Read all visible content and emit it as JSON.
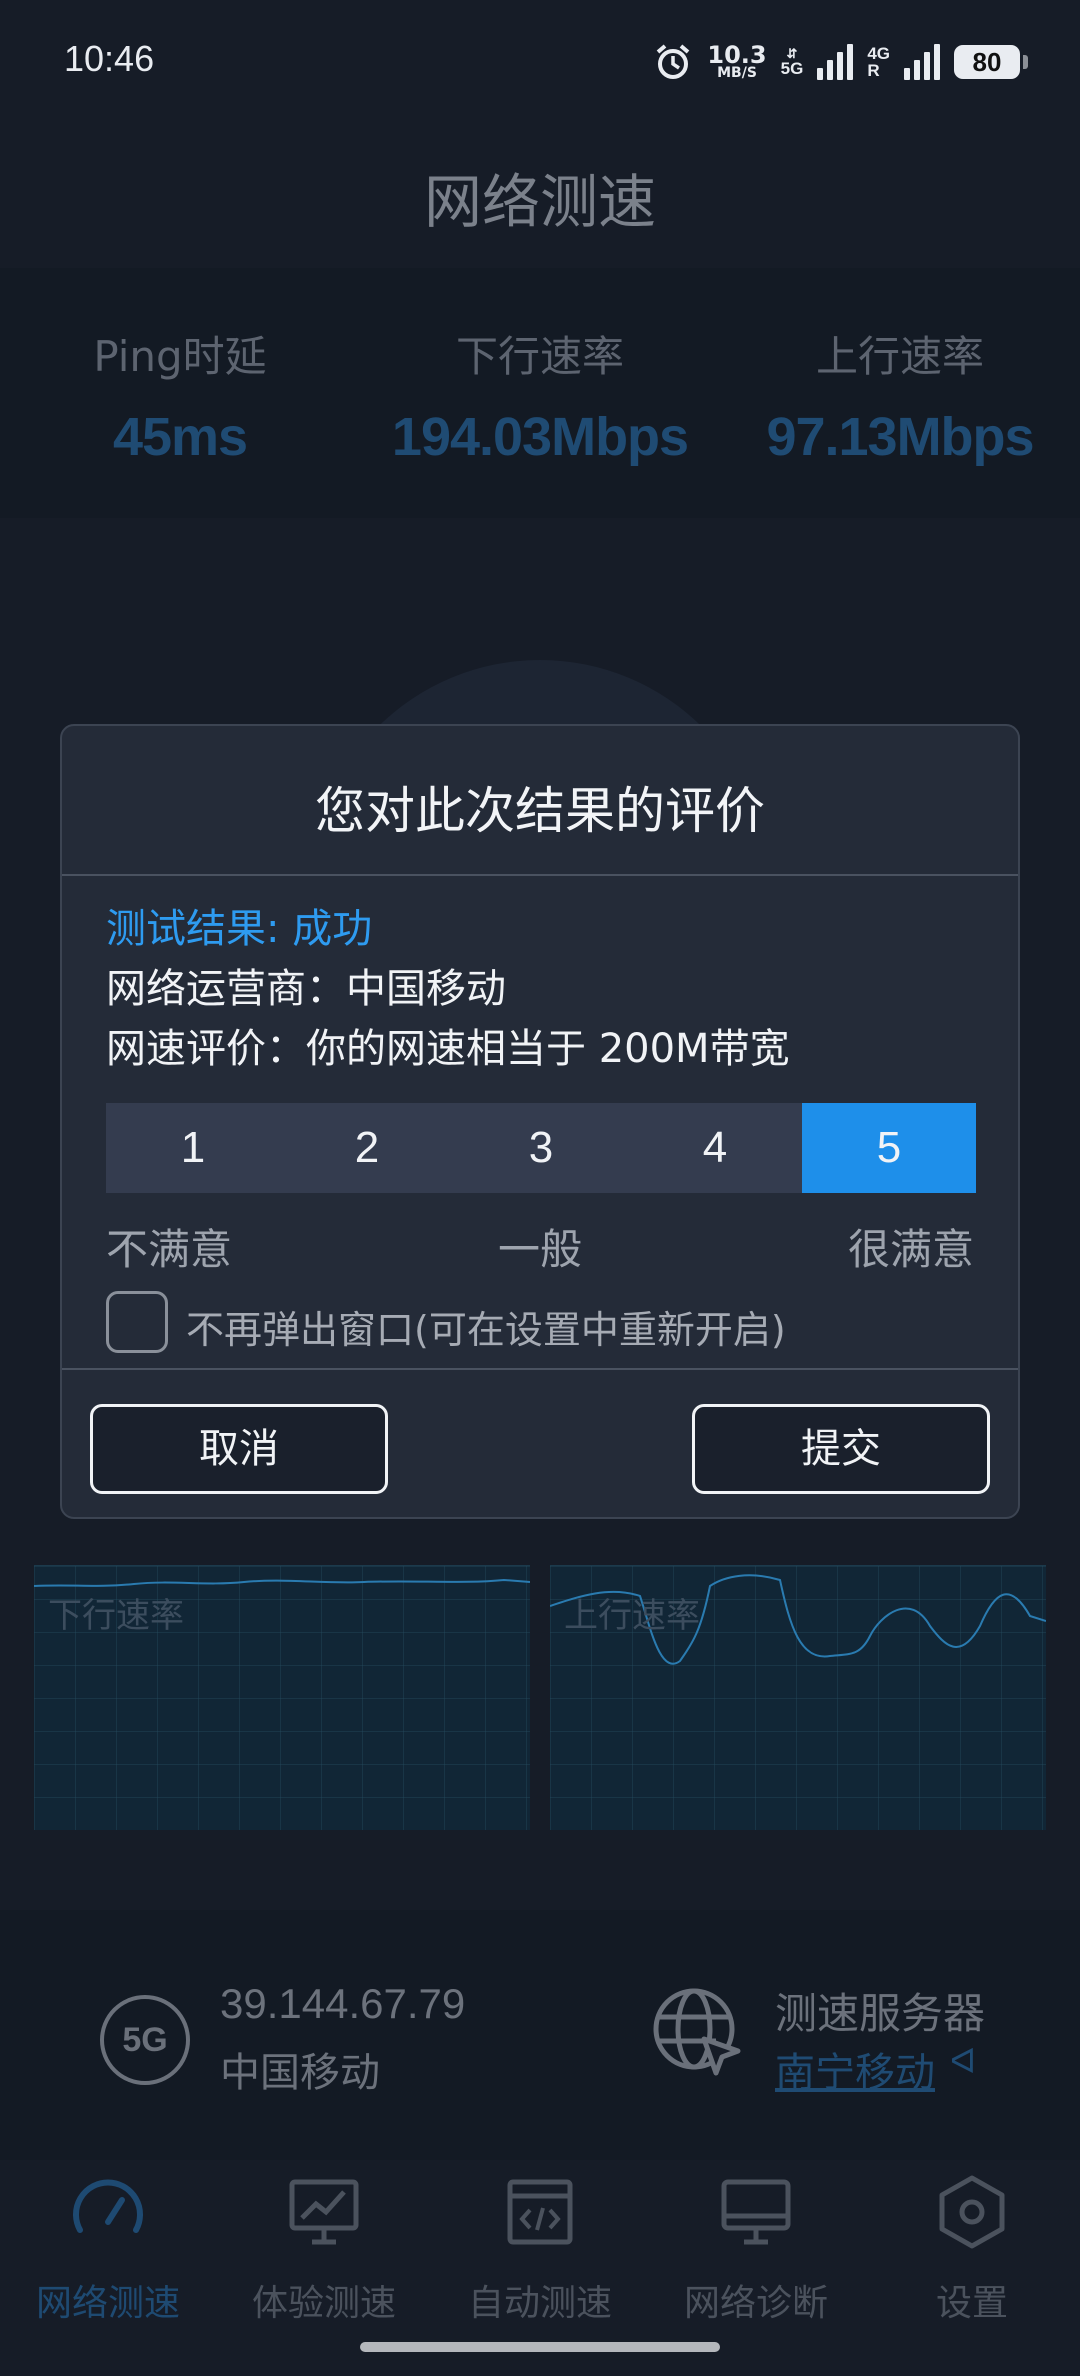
{
  "status_bar": {
    "time": "10:46",
    "net_speed_value": "10.3",
    "net_speed_unit": "MB/S",
    "sim1_type": "5G",
    "sim2_type": "4G",
    "sim2_roaming": "R",
    "battery": "80"
  },
  "page": {
    "title": "网络测速"
  },
  "metrics": {
    "ping_label": "Ping时延",
    "ping_value": "45ms",
    "download_label": "下行速率",
    "download_value": "194.03Mbps",
    "upload_label": "上行速率",
    "upload_value": "97.13Mbps"
  },
  "charts": {
    "download_label": "下行速率",
    "upload_label": "上行速率",
    "line_color": "#2a7bb0"
  },
  "connection": {
    "network_type": "5G",
    "ip": "39.144.67.79",
    "carrier": "中国移动",
    "server_title": "测速服务器",
    "server_name": "南宁移动",
    "server_arrow": "ᐊ"
  },
  "nav": {
    "items": [
      {
        "label": "网络测速",
        "icon": "speedometer-icon",
        "active": true
      },
      {
        "label": "体验测速",
        "icon": "chart-monitor-icon",
        "active": false
      },
      {
        "label": "自动测速",
        "icon": "code-window-icon",
        "active": false
      },
      {
        "label": "网络诊断",
        "icon": "desktop-icon",
        "active": false
      },
      {
        "label": "设置",
        "icon": "hexagon-settings-icon",
        "active": false
      }
    ]
  },
  "dialog": {
    "title": "您对此次结果的评价",
    "result_status": "测试结果: 成功",
    "carrier_line": "网络运营商：中国移动",
    "speed_eval": "网速评价：你的网速相当于 200M带宽",
    "rating_options": [
      "1",
      "2",
      "3",
      "4",
      "5"
    ],
    "selected_rating": 5,
    "scale_low": "不满意",
    "scale_mid": "一般",
    "scale_high": "很满意",
    "no_popup_label": "不再弹出窗口(可在设置中重新开启)",
    "no_popup_checked": false,
    "cancel_label": "取消",
    "submit_label": "提交",
    "accent_color": "#1e8fea"
  }
}
